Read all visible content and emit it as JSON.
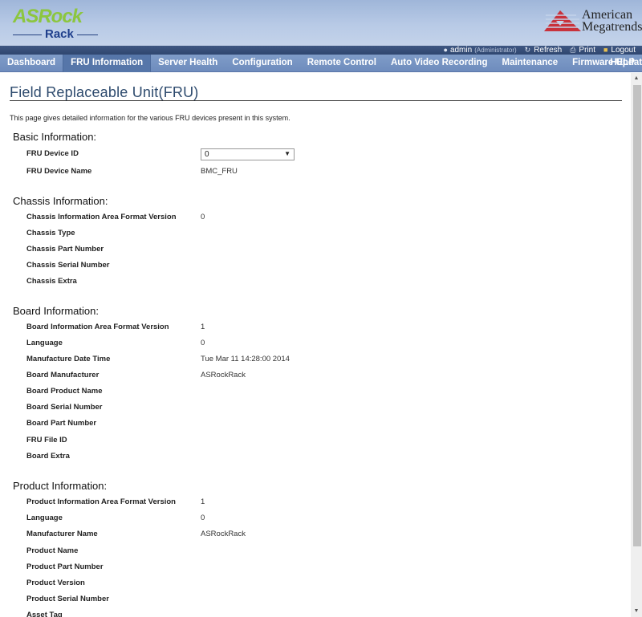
{
  "branding": {
    "left_logo_top": "ASRock",
    "left_logo_bottom": "Rack",
    "right_logo_line1": "American",
    "right_logo_line2": "Megatrends"
  },
  "userbar": {
    "username": "admin",
    "role": "(Administrator)",
    "refresh": "Refresh",
    "print": "Print",
    "logout": "Logout"
  },
  "nav": {
    "items": [
      {
        "label": "Dashboard"
      },
      {
        "label": "FRU Information",
        "active": true
      },
      {
        "label": "Server Health"
      },
      {
        "label": "Configuration"
      },
      {
        "label": "Remote Control"
      },
      {
        "label": "Auto Video Recording"
      },
      {
        "label": "Maintenance"
      },
      {
        "label": "Firmware Update"
      },
      {
        "label": "HELP"
      }
    ]
  },
  "page": {
    "title": "Field Replaceable Unit(FRU)",
    "description": "This page gives detailed information for the various FRU devices present in this system."
  },
  "sections": {
    "basic": {
      "title": "Basic Information:",
      "rows": [
        {
          "label": "FRU Device ID",
          "value": "0"
        },
        {
          "label": "FRU Device Name",
          "value": "BMC_FRU"
        }
      ]
    },
    "chassis": {
      "title": "Chassis Information:",
      "rows": [
        {
          "label": "Chassis Information Area Format Version",
          "value": "0"
        },
        {
          "label": "Chassis Type",
          "value": ""
        },
        {
          "label": "Chassis Part Number",
          "value": ""
        },
        {
          "label": "Chassis Serial Number",
          "value": ""
        },
        {
          "label": "Chassis Extra",
          "value": ""
        }
      ]
    },
    "board": {
      "title": "Board Information:",
      "rows": [
        {
          "label": "Board Information Area Format Version",
          "value": "1"
        },
        {
          "label": "Language",
          "value": "0"
        },
        {
          "label": "Manufacture Date Time",
          "value": "Tue Mar 11 14:28:00 2014"
        },
        {
          "label": "Board Manufacturer",
          "value": "ASRockRack"
        },
        {
          "label": "Board Product Name",
          "value": ""
        },
        {
          "label": "Board Serial Number",
          "value": ""
        },
        {
          "label": "Board Part Number",
          "value": ""
        },
        {
          "label": "FRU File ID",
          "value": ""
        },
        {
          "label": "Board Extra",
          "value": ""
        }
      ]
    },
    "product": {
      "title": "Product Information:",
      "rows": [
        {
          "label": "Product Information Area Format Version",
          "value": "1"
        },
        {
          "label": "Language",
          "value": "0"
        },
        {
          "label": "Manufacturer Name",
          "value": "ASRockRack"
        },
        {
          "label": "Product Name",
          "value": ""
        },
        {
          "label": "Product Part Number",
          "value": ""
        },
        {
          "label": "Product Version",
          "value": ""
        },
        {
          "label": "Product Serial Number",
          "value": ""
        },
        {
          "label": "Asset Tag",
          "value": ""
        }
      ]
    }
  },
  "colors": {
    "nav_bg": "#7592c2",
    "nav_active": "#5676a9",
    "title_color": "#2d4a6d",
    "asrock_green": "#8cc63f",
    "rack_blue": "#1f3f8c",
    "ami_red": "#c8323c"
  }
}
